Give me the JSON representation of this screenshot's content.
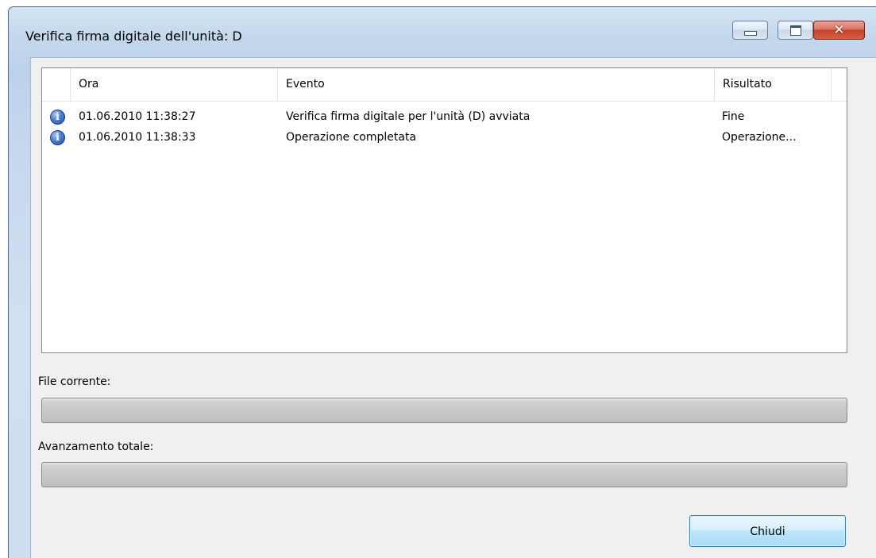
{
  "window": {
    "title": "Verifica firma digitale dell'unità: D",
    "controls": {
      "minimize_icon": "minimize-icon",
      "maximize_icon": "maximize-icon",
      "close_icon": "close-icon",
      "close_glyph": "✕"
    }
  },
  "log": {
    "columns": {
      "ora": "Ora",
      "evento": "Evento",
      "risultato": "Risultato"
    },
    "rows": [
      {
        "icon": "info-icon",
        "icon_glyph": "i",
        "ora": "01.06.2010 11:38:27",
        "evento": "Verifica firma digitale per l'unità (D) avviata",
        "risultato": "Fine"
      },
      {
        "icon": "info-icon",
        "icon_glyph": "i",
        "ora": "01.06.2010 11:38:33",
        "evento": "Operazione completata",
        "risultato": "Operazione..."
      }
    ]
  },
  "progress": {
    "current_file_label": "File corrente:",
    "current_file_value": 0,
    "total_label": "Avanzamento totale:",
    "total_value": 0
  },
  "buttons": {
    "close_label": "Chiudi"
  },
  "colors": {
    "accent": "#3c7fb1",
    "close_button_red": "#c5412a"
  }
}
